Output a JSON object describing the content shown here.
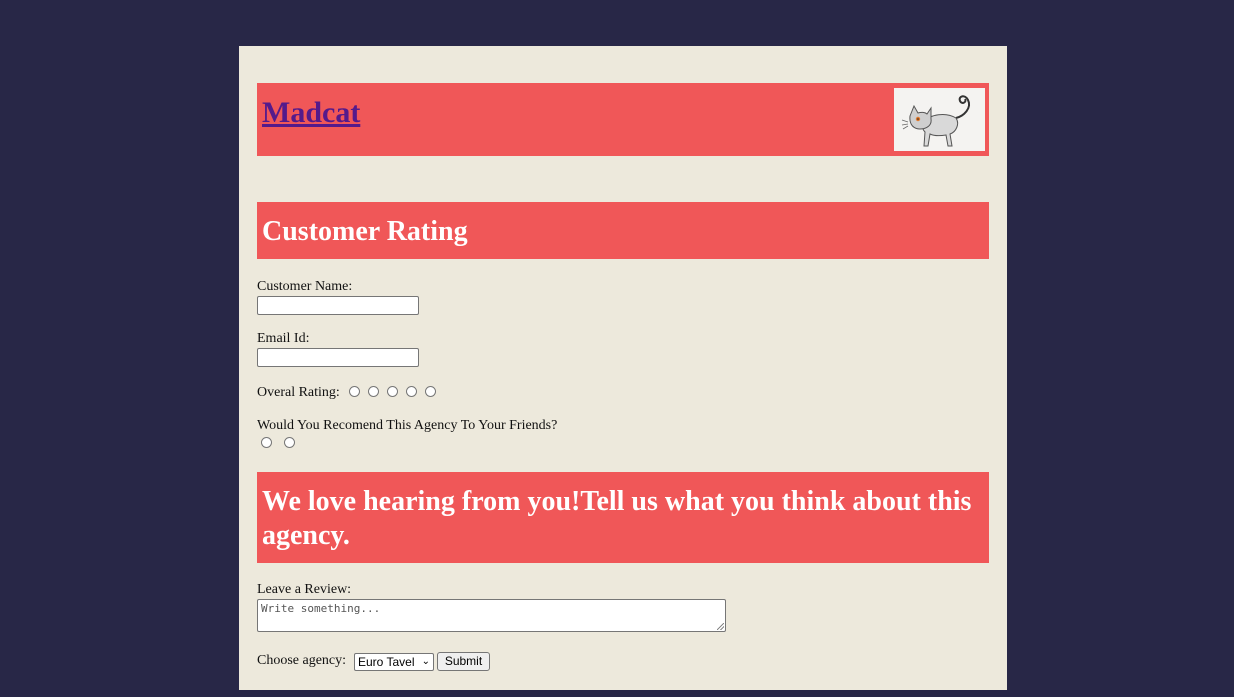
{
  "header": {
    "site_title": "Madcat"
  },
  "rating_section": {
    "heading": "Customer Rating",
    "customer_name_label": "Customer Name:",
    "customer_name_value": "",
    "email_label": "Email Id:",
    "email_value": "",
    "overall_rating_label": "Overal Rating:",
    "rating_options_count": 5,
    "recommend_question": "Would You Recomend This Agency To Your Friends?",
    "recommend_options_count": 2
  },
  "review_section": {
    "heading": "We love hearing from you!Tell us what you think about this agency.",
    "review_label": "Leave a Review:",
    "review_placeholder": "Write something...",
    "agency_label": "Choose agency:",
    "agency_selected": "Euro Tavel",
    "submit_label": "Submit"
  },
  "colors": {
    "background": "#282747",
    "panel": "#ede9dc",
    "banner": "#f05758",
    "link": "#551a8b"
  },
  "icons": {
    "logo": "cat-logo-icon",
    "dropdown": "chevron-down-icon"
  }
}
